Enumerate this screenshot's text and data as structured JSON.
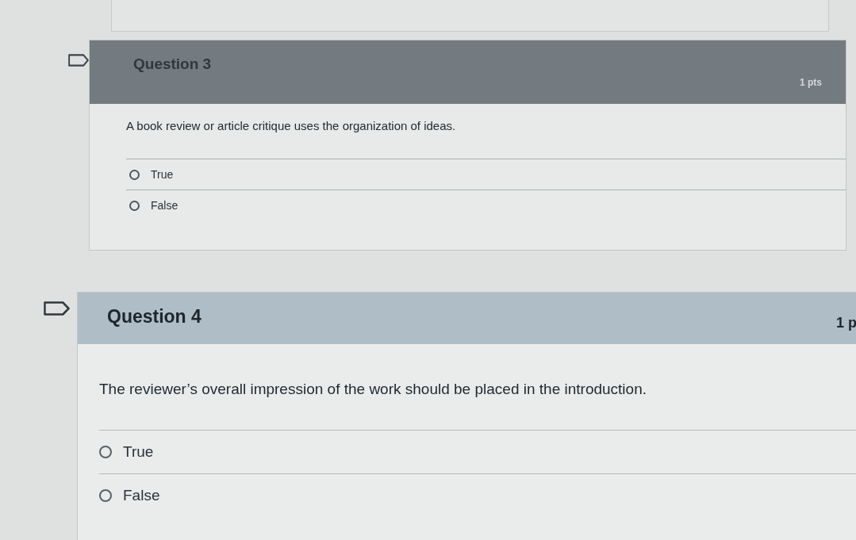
{
  "questions": [
    {
      "title": "Question 3",
      "points": "1 pts",
      "flagged": false,
      "text": "A book review or article critique uses the organization of ideas.",
      "answers": [
        {
          "label": "True",
          "selected": false
        },
        {
          "label": "False",
          "selected": false
        }
      ]
    },
    {
      "title": "Question 4",
      "points": "1 p",
      "flagged": false,
      "text": "The reviewer’s overall impression of the work should be placed in the introduction.",
      "answers": [
        {
          "label": "True",
          "selected": false
        },
        {
          "label": "False",
          "selected": false
        }
      ]
    }
  ]
}
